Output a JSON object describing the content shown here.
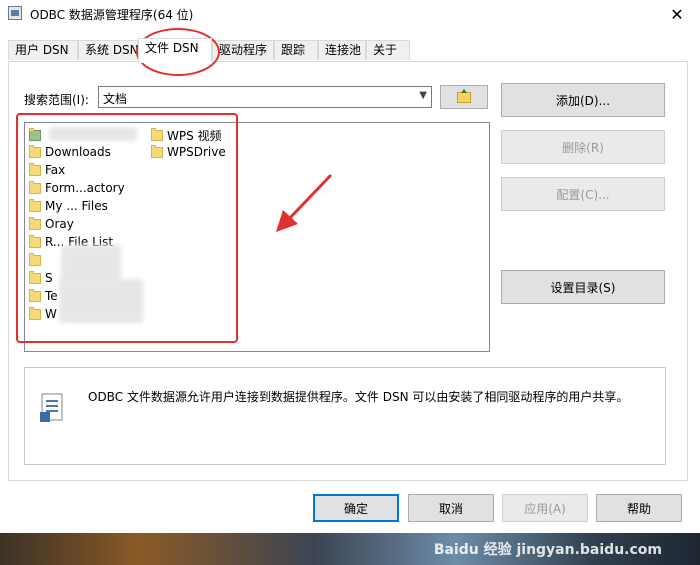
{
  "window": {
    "title": "ODBC 数据源管理程序(64 位)",
    "close_glyph": "✕"
  },
  "tabs": [
    {
      "label": "用户 DSN"
    },
    {
      "label": "系统 DSN"
    },
    {
      "label": "文件 DSN",
      "active": true
    },
    {
      "label": "驱动程序"
    },
    {
      "label": "跟踪"
    },
    {
      "label": "连接池"
    },
    {
      "label": "关于"
    }
  ],
  "search": {
    "label": "搜索范围(I):",
    "value": "文档"
  },
  "file_list": {
    "items_left": [
      "Downloads",
      "Fax",
      "Form...actory",
      "My ... Files",
      "Oray",
      "R... File List",
      "S",
      "Te",
      "W"
    ],
    "items_right": [
      "WPS 视频",
      "WPSDrive"
    ]
  },
  "side_buttons": {
    "add": "添加(D)...",
    "delete": "删除(R)",
    "configure": "配置(C)...",
    "set_dir": "设置目录(S)"
  },
  "description": "ODBC 文件数据源允许用户连接到数据提供程序。文件 DSN 可以由安装了相同驱动程序的用户共享。",
  "bottom_buttons": {
    "ok": "确定",
    "cancel": "取消",
    "apply": "应用(A)",
    "help": "帮助"
  },
  "watermark": "Baidu 经验 jingyan.baidu.com",
  "colors": {
    "annotation_red": "#e0312e",
    "primary_border": "#0078d7"
  }
}
